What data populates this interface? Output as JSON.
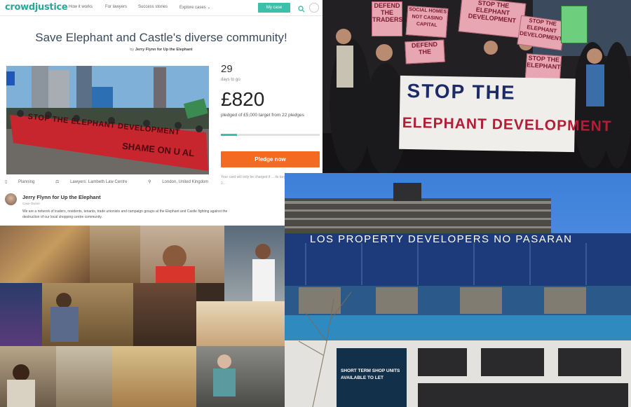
{
  "crowdjustice": {
    "logo": "crowdjustice",
    "nav": [
      "How it works",
      "For lawyers",
      "Success stories",
      "Explore cases"
    ],
    "my_case": "My case",
    "title": "Save Elephant and Castle's diverse community!",
    "byline_prefix": "by",
    "byline_author": "Jerry Flynn for Up the Elephant",
    "days": "29",
    "days_label": "days to go",
    "amount": "£820",
    "pledged_text": "pledged of £5,000 target from 22 pledges",
    "progress_fraction": 0.164,
    "pledge_button": "Pledge now",
    "notice": "Your card will only be charged if ... its target of £5,000 by Apr. 04, 2...",
    "tags": [
      "Planning",
      "Lawyers: Lambeth Law Centre",
      "London, United Kingdom"
    ],
    "owner_name": "Jerry Flynn for Up the Elephant",
    "owner_role": "Case Owner",
    "description": "We are a network of traders, residents, tenants, trade unionists and campaign groups at the Elephant and Castle fighting against the destruction of our local shopping centre community.",
    "accent_color": "#3cc0aa",
    "button_color": "#f56a21"
  },
  "hero_banner": {
    "line1": "STOP THE ELEPHANT DEVELOPMENT",
    "line2": "SHAME ON U AL"
  },
  "protest": {
    "signs": [
      "DEFEND THE TRADERS",
      "SOCIAL HOMES NOT CASINO CAPITAL",
      "STOP THE ELEPHANT DEVELOPMENT",
      "STOP THE ELEPHANT DEVELOPMENT",
      "DEFEND THE",
      "STOP THE ELEPHANT"
    ],
    "banner_line1": "STOP THE",
    "banner_line2": "ELEPHANT DEVELOPMENT"
  },
  "building": {
    "slogan": "LOS PROPERTY DEVELOPERS NO PASARAN",
    "shop_sign_line1": "SHORT TERM SHOP UNITS",
    "shop_sign_line2": "AVAILABLE TO LET"
  }
}
